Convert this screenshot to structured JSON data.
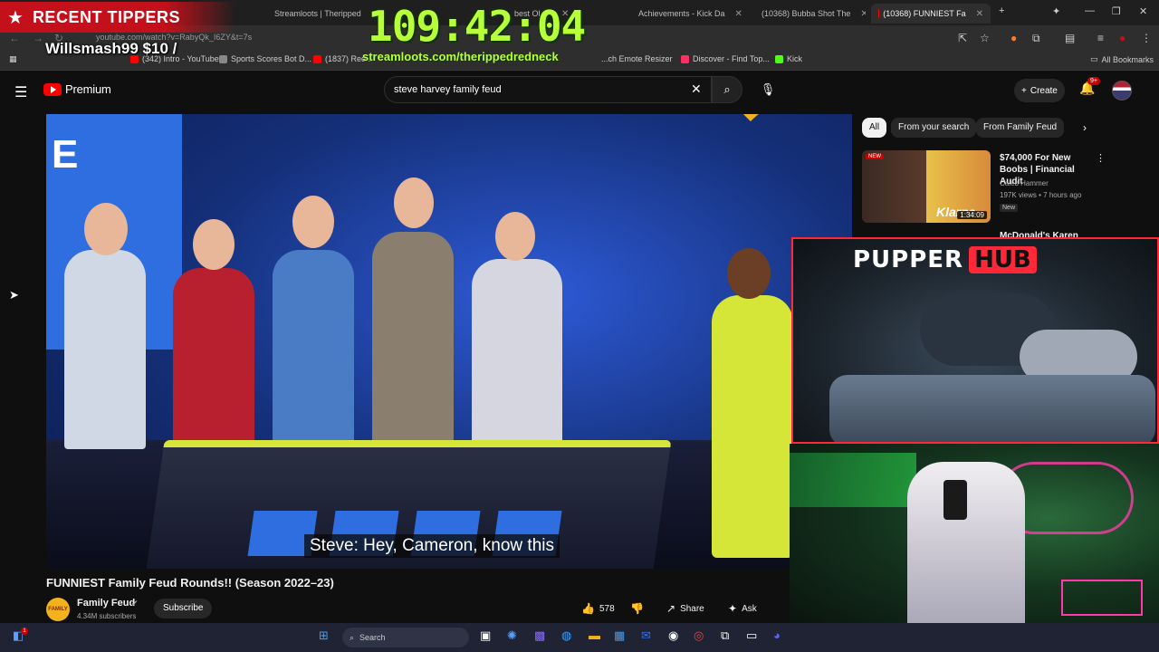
{
  "browser": {
    "tabs": [
      {
        "label": "Streamloots | Theripped",
        "color": "#c4101a"
      },
      {
        "label": "best Ola...",
        "color": "#2a72ff"
      },
      {
        "label": "Achievements - Kick Da",
        "color": "#53fc18"
      },
      {
        "label": "(10368) Bubba Shot The",
        "color": "#ff0000"
      },
      {
        "label": "(10368) FUNNIEST Fa",
        "color": "#ff0000"
      }
    ],
    "url": "youtube.com/watch?v=RabyQk_I6ZY&t=7s",
    "bookmarks": [
      {
        "label": "(342) Intro - YouTube",
        "color": "#ff0000"
      },
      {
        "label": "Sports Scores Bot D...",
        "color": "#888888"
      },
      {
        "label": "(1837) Red...",
        "color": "#ff0000"
      },
      {
        "label": "...ch Emote Resizer",
        "color": "#9146ff"
      },
      {
        "label": "Discover - Find Top...",
        "color": "#ff2e63"
      },
      {
        "label": "Kick",
        "color": "#53fc18"
      }
    ],
    "all_bookmarks": "All Bookmarks"
  },
  "overlay": {
    "recent_tippers": "RECENT TIPPERS",
    "tipper": "Willsmash99 $10 /",
    "timer": "109:42:04",
    "stream_url": "streamloots.com/therippedredneck",
    "brand_a": "PUPPER",
    "brand_b": "HUB"
  },
  "youtube": {
    "logo": "Premium",
    "search_value": "steve harvey family feud",
    "create_label": "Create",
    "notif_count": "9+",
    "caption": "Steve: Hey, Cameron, know this",
    "video_title": "FUNNIEST Family Feud Rounds!! (Season 2022–23)",
    "channel_name": "Family Feud",
    "channel_avatar_text": "FAMILY FEUD",
    "subscribers": "4.34M subscribers",
    "subscribe_label": "Subscribe",
    "likes": "578",
    "share_label": "Share",
    "ask_label": "Ask",
    "chips": [
      "All",
      "From your search",
      "From Family Feud"
    ],
    "recommendations": [
      {
        "title": "$74,000 For New Boobs | Financial Audit",
        "channel": "Caleb Hammer",
        "meta": "197K views • 7 hours ago",
        "badge": "New",
        "duration": "1:34:09",
        "thumb_brand": "Klarna",
        "thumb_tag": "NEW"
      },
      {
        "title": "McDonald's Karen"
      }
    ]
  },
  "taskbar": {
    "search_label": "Search",
    "notif_badge": "1"
  }
}
